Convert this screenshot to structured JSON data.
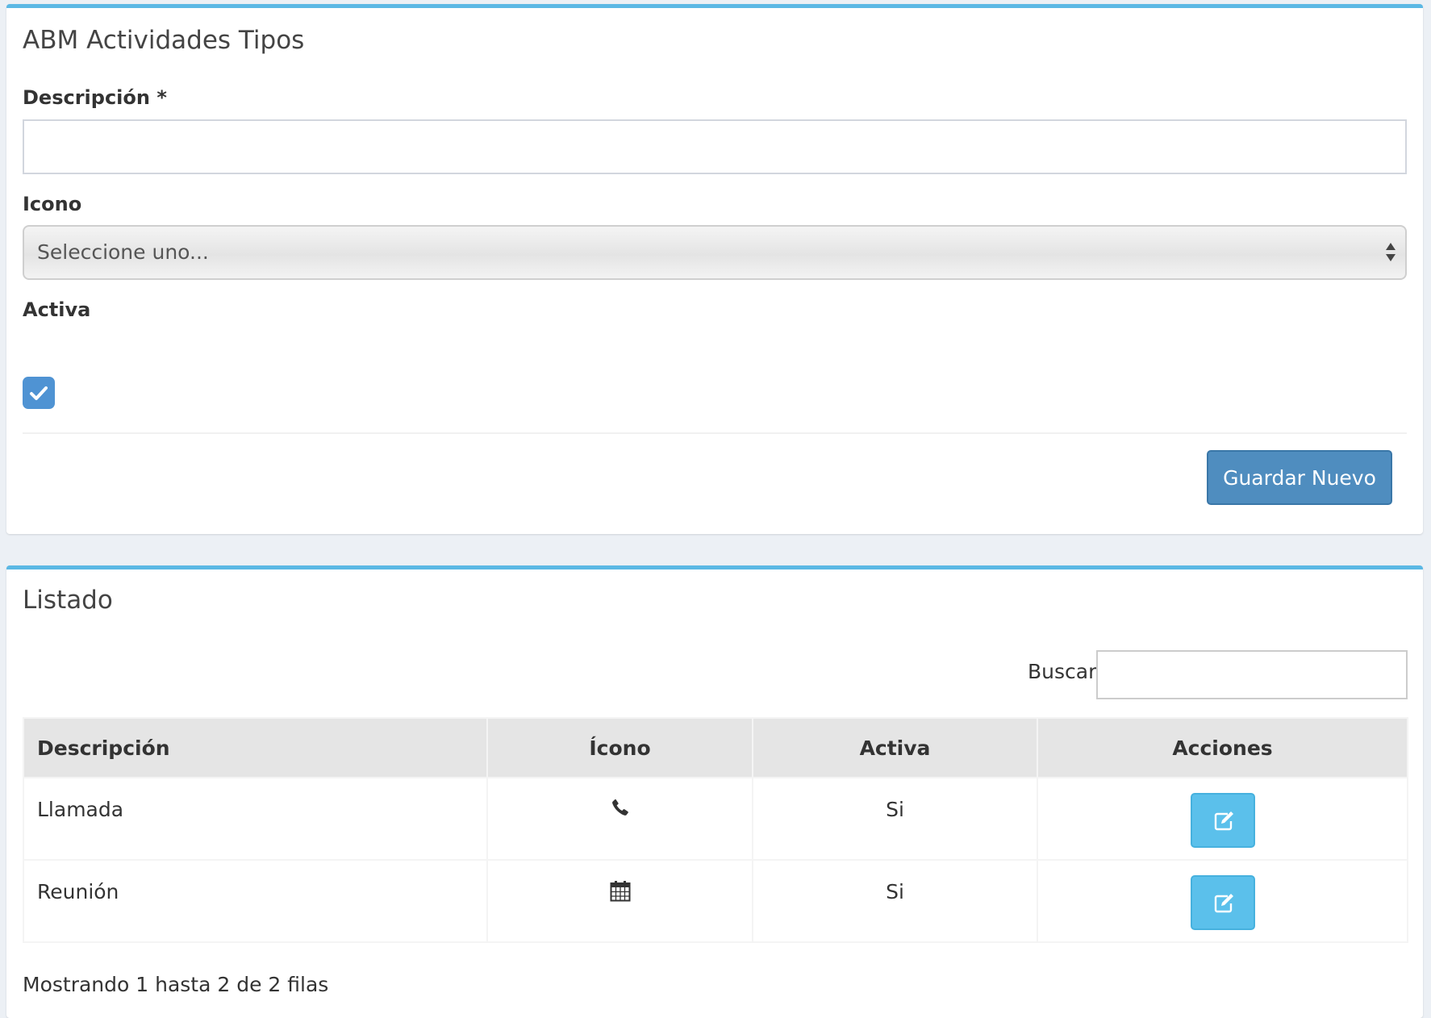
{
  "form": {
    "title": "ABM Actividades Tipos",
    "descripcion_label": "Descripción *",
    "descripcion_value": "",
    "icono_label": "Icono",
    "icono_selected": "Seleccione uno...",
    "activa_label": "Activa",
    "activa_checked": true,
    "save_label": "Guardar Nuevo"
  },
  "listado": {
    "title": "Listado",
    "search_label": "Buscar:",
    "search_value": "",
    "columns": [
      "Descripción",
      "Ícono",
      "Activa",
      "Acciones"
    ],
    "rows": [
      {
        "descripcion": "Llamada",
        "icon": "phone-icon",
        "activa": "Si"
      },
      {
        "descripcion": "Reunión",
        "icon": "calendar-icon",
        "activa": "Si"
      }
    ],
    "info": "Mostrando 1 hasta 2 de 2 filas"
  },
  "colors": {
    "accent": "#5bb8e4",
    "save_button": "#4f8dbf",
    "edit_button": "#5bc0eb",
    "checkbox": "#4f93d3",
    "page_bg": "#ecf0f5"
  }
}
